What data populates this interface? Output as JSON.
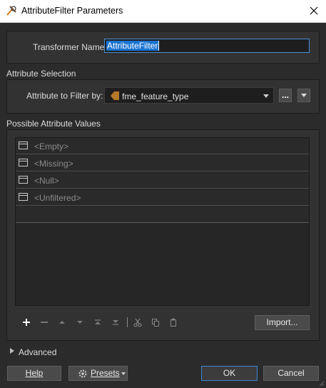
{
  "window": {
    "title": "AttributeFilter Parameters"
  },
  "transformer": {
    "label": "Transformer Name:",
    "value": "AttributeFilter"
  },
  "attribute_selection": {
    "heading": "Attribute Selection",
    "filter_label": "Attribute to Filter by:",
    "filter_value": "fme_feature_type",
    "ellipsis_label": "..."
  },
  "possible_values": {
    "heading": "Possible Attribute Values",
    "rows": [
      "<Empty>",
      "<Missing>",
      "<Null>",
      "<Unfiltered>"
    ]
  },
  "toolbar": {
    "import_label": "Import..."
  },
  "advanced": {
    "label": "Advanced"
  },
  "footer": {
    "help_label": "Help",
    "presets_label": "Presets",
    "ok_label": "OK",
    "cancel_label": "Cancel"
  },
  "colors": {
    "accent": "#3d86d6",
    "dialog_bg": "#2b2b2b"
  }
}
